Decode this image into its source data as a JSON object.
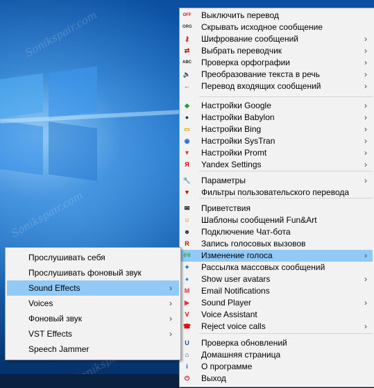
{
  "watermark": "Sonikspair.com",
  "main_menu": {
    "items": [
      {
        "label": "Выключить перевод",
        "icon": "off-icon",
        "glyph": "OFF",
        "color": "#d11",
        "arrow": false
      },
      {
        "label": "Скрывать исходное сообщение",
        "icon": "org-icon",
        "glyph": "ORG",
        "color": "#333",
        "arrow": false
      },
      {
        "label": "Шифрование сообщений",
        "icon": "key-icon",
        "glyph": "⚷",
        "color": "#c00",
        "arrow": true
      },
      {
        "label": "Выбрать переводчик",
        "icon": "arrows-icon",
        "glyph": "⇄",
        "color": "#c00",
        "arrow": true
      },
      {
        "label": "Проверка орфографии",
        "icon": "abc-icon",
        "glyph": "ABC",
        "color": "#222",
        "arrow": true
      },
      {
        "label": "Преобразование текста в речь",
        "icon": "speaker-icon",
        "glyph": "🔈",
        "color": "#222",
        "arrow": true
      },
      {
        "label": "Перевод входящих сообщений",
        "icon": "incoming-arrow-icon",
        "glyph": "←",
        "color": "#c00",
        "arrow": true
      },
      {
        "label": "Настройки Google",
        "icon": "google-icon",
        "glyph": "◆",
        "color": "#2a9d3a",
        "arrow": true
      },
      {
        "label": "Настройки Babylon",
        "icon": "babylon-icon",
        "glyph": "●",
        "color": "#135",
        "arrow": true
      },
      {
        "label": "Настройки Bing",
        "icon": "bing-icon",
        "glyph": "▭",
        "color": "#e0a000",
        "arrow": true
      },
      {
        "label": "Настройки SysTran",
        "icon": "systran-icon",
        "glyph": "◉",
        "color": "#1a6fd0",
        "arrow": true
      },
      {
        "label": "Настройки Promt",
        "icon": "promt-icon",
        "glyph": "▼",
        "color": "#d33",
        "arrow": true
      },
      {
        "label": "Yandex Settings",
        "icon": "yandex-icon",
        "glyph": "Я",
        "color": "#d00",
        "arrow": true
      },
      {
        "label": "Параметры",
        "icon": "wrench-icon",
        "glyph": "🔧",
        "color": "#333",
        "arrow": true
      },
      {
        "label": "Фильтры пользовательского перевода",
        "icon": "filter-icon",
        "glyph": "▼",
        "color": "#c00",
        "arrow": false
      },
      {
        "label": "Приветствия",
        "icon": "envelope-icon",
        "glyph": "✉",
        "color": "#000",
        "arrow": false
      },
      {
        "label": "Шаблоны сообщений Fun&Art",
        "icon": "smiley-icon",
        "glyph": "☺",
        "color": "#e08000",
        "arrow": false
      },
      {
        "label": "Подключение Чат-бота",
        "icon": "bot-icon",
        "glyph": "☻",
        "color": "#333",
        "arrow": false
      },
      {
        "label": "Запись голосовых вызовов",
        "icon": "record-icon",
        "glyph": "R",
        "color": "#c00",
        "arrow": false
      },
      {
        "label": "Изменение голоса",
        "icon": "voice-change-icon",
        "glyph": "((•))",
        "color": "#1a9a1a",
        "arrow": true
      },
      {
        "label": "Рассылка массовых сообщений",
        "icon": "broadcast-icon",
        "glyph": "✦",
        "color": "#1a6fd0",
        "arrow": false
      },
      {
        "label": "Show user avatars",
        "icon": "avatar-icon",
        "glyph": "●",
        "color": "#1a8fe0",
        "arrow": true
      },
      {
        "label": "Email Notifications",
        "icon": "gmail-icon",
        "glyph": "M",
        "color": "#d33",
        "arrow": false
      },
      {
        "label": "Sound Player",
        "icon": "play-icon",
        "glyph": "▶",
        "color": "#d33",
        "arrow": true
      },
      {
        "label": "Voice Assistant",
        "icon": "voice-assistant-icon",
        "glyph": "V",
        "color": "#d00",
        "arrow": false
      },
      {
        "label": "Reject voice calls",
        "icon": "reject-call-icon",
        "glyph": "☎",
        "color": "#d00",
        "arrow": true
      },
      {
        "label": "Проверка обновлений",
        "icon": "update-icon",
        "glyph": "U",
        "color": "#1a4fb0",
        "arrow": false
      },
      {
        "label": "Домашняя страница",
        "icon": "home-icon",
        "glyph": "⌂",
        "color": "#1a4fb0",
        "arrow": false
      },
      {
        "label": "О программе",
        "icon": "info-icon",
        "glyph": "i",
        "color": "#1a4fb0",
        "arrow": false
      },
      {
        "label": "Выход",
        "icon": "power-icon",
        "glyph": "⏻",
        "color": "#d00",
        "arrow": false
      }
    ]
  },
  "sub_menu": {
    "items": [
      {
        "label": "Прослушивать себя",
        "arrow": false
      },
      {
        "label": "Прослушивать фоновый звук",
        "arrow": false
      },
      {
        "label": "Sound Effects",
        "arrow": true
      },
      {
        "label": "Voices",
        "arrow": true
      },
      {
        "label": "Фоновый звук",
        "arrow": true
      },
      {
        "label": "VST Effects",
        "arrow": true
      },
      {
        "label": "Speech Jammer",
        "arrow": false
      }
    ]
  }
}
